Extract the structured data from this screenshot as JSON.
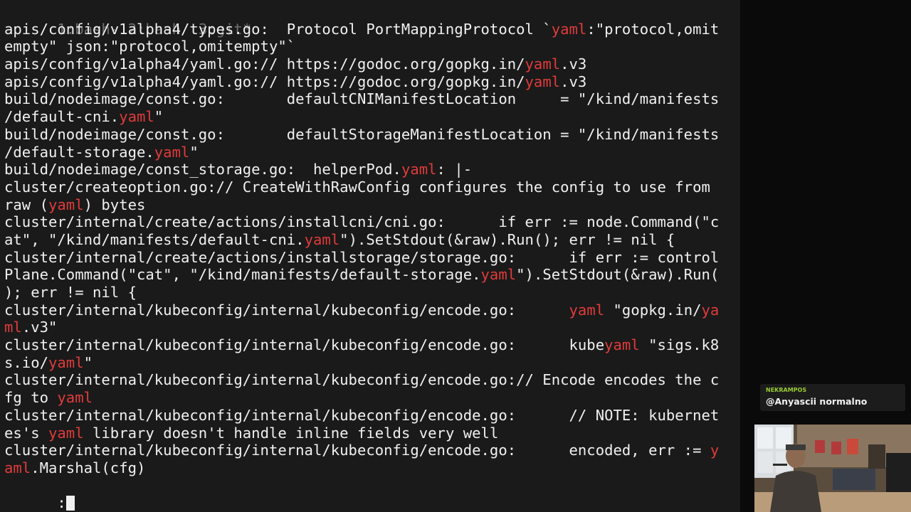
{
  "tmux": {
    "tabs": [
      "1:bash-",
      "2:bash",
      "3:git*"
    ]
  },
  "terminal_lines": [
    [
      {
        "t": "apis/config/v1alpha4/types.go:  Protocol PortMappingProtocol `"
      },
      {
        "t": "yaml",
        "h": true
      },
      {
        "t": ":\"protocol,omit"
      }
    ],
    [
      {
        "t": "empty\" json:\"protocol,omitempty\"`"
      }
    ],
    [
      {
        "t": "apis/config/v1alpha4/yaml.go:// https://godoc.org/gopkg.in/"
      },
      {
        "t": "yaml",
        "h": true
      },
      {
        "t": ".v3"
      }
    ],
    [
      {
        "t": "apis/config/v1alpha4/yaml.go:// https://godoc.org/gopkg.in/"
      },
      {
        "t": "yaml",
        "h": true
      },
      {
        "t": ".v3"
      }
    ],
    [
      {
        "t": "build/nodeimage/const.go:       defaultCNIManifestLocation     = \"/kind/manifests"
      }
    ],
    [
      {
        "t": "/default-cni."
      },
      {
        "t": "yaml",
        "h": true
      },
      {
        "t": "\""
      }
    ],
    [
      {
        "t": "build/nodeimage/const.go:       defaultStorageManifestLocation = \"/kind/manifests"
      }
    ],
    [
      {
        "t": "/default-storage."
      },
      {
        "t": "yaml",
        "h": true
      },
      {
        "t": "\""
      }
    ],
    [
      {
        "t": "build/nodeimage/const_storage.go:  helperPod."
      },
      {
        "t": "yaml",
        "h": true
      },
      {
        "t": ": |-"
      }
    ],
    [
      {
        "t": "cluster/createoption.go:// CreateWithRawConfig configures the config to use from"
      }
    ],
    [
      {
        "t": "raw ("
      },
      {
        "t": "yaml",
        "h": true
      },
      {
        "t": ") bytes"
      }
    ],
    [
      {
        "t": "cluster/internal/create/actions/installcni/cni.go:      if err := node.Command(\"c"
      }
    ],
    [
      {
        "t": "at\", \"/kind/manifests/default-cni."
      },
      {
        "t": "yaml",
        "h": true
      },
      {
        "t": "\").SetStdout(&raw).Run(); err != nil {"
      }
    ],
    [
      {
        "t": "cluster/internal/create/actions/installstorage/storage.go:      if err := control"
      }
    ],
    [
      {
        "t": "Plane.Command(\"cat\", \"/kind/manifests/default-storage."
      },
      {
        "t": "yaml",
        "h": true
      },
      {
        "t": "\").SetStdout(&raw).Run("
      }
    ],
    [
      {
        "t": "); err != nil {"
      }
    ],
    [
      {
        "t": "cluster/internal/kubeconfig/internal/kubeconfig/encode.go:      "
      },
      {
        "t": "yaml",
        "h": true
      },
      {
        "t": " \"gopkg.in/"
      },
      {
        "t": "ya",
        "h": true
      }
    ],
    [
      {
        "t": "ml",
        "h": true
      },
      {
        "t": ".v3\""
      }
    ],
    [
      {
        "t": "cluster/internal/kubeconfig/internal/kubeconfig/encode.go:      kube"
      },
      {
        "t": "yaml",
        "h": true
      },
      {
        "t": " \"sigs.k8"
      }
    ],
    [
      {
        "t": "s.io/"
      },
      {
        "t": "yaml",
        "h": true
      },
      {
        "t": "\""
      }
    ],
    [
      {
        "t": "cluster/internal/kubeconfig/internal/kubeconfig/encode.go:// Encode encodes the c"
      }
    ],
    [
      {
        "t": "fg to "
      },
      {
        "t": "yaml",
        "h": true
      }
    ],
    [
      {
        "t": "cluster/internal/kubeconfig/internal/kubeconfig/encode.go:      // NOTE: kubernet"
      }
    ],
    [
      {
        "t": "es's "
      },
      {
        "t": "yaml",
        "h": true
      },
      {
        "t": " library doesn't handle inline fields very well"
      }
    ],
    [
      {
        "t": "cluster/internal/kubeconfig/internal/kubeconfig/encode.go:      encoded, err := "
      },
      {
        "t": "y",
        "h": true
      }
    ],
    [
      {
        "t": "aml",
        "h": true
      },
      {
        "t": ".Marshal(cfg)"
      }
    ]
  ],
  "prompt": ":",
  "chat": {
    "username": "NEKRAMPOS",
    "message": "@Anyascii normalno"
  },
  "colors": {
    "terminal_bg": "#1a1a1a",
    "text": "#f0f0f0",
    "highlight": "#e03b3b",
    "tab_dim": "#6e6e6e",
    "chat_username": "#9acd32"
  },
  "icons": {
    "webcam": "webcam-feed"
  }
}
